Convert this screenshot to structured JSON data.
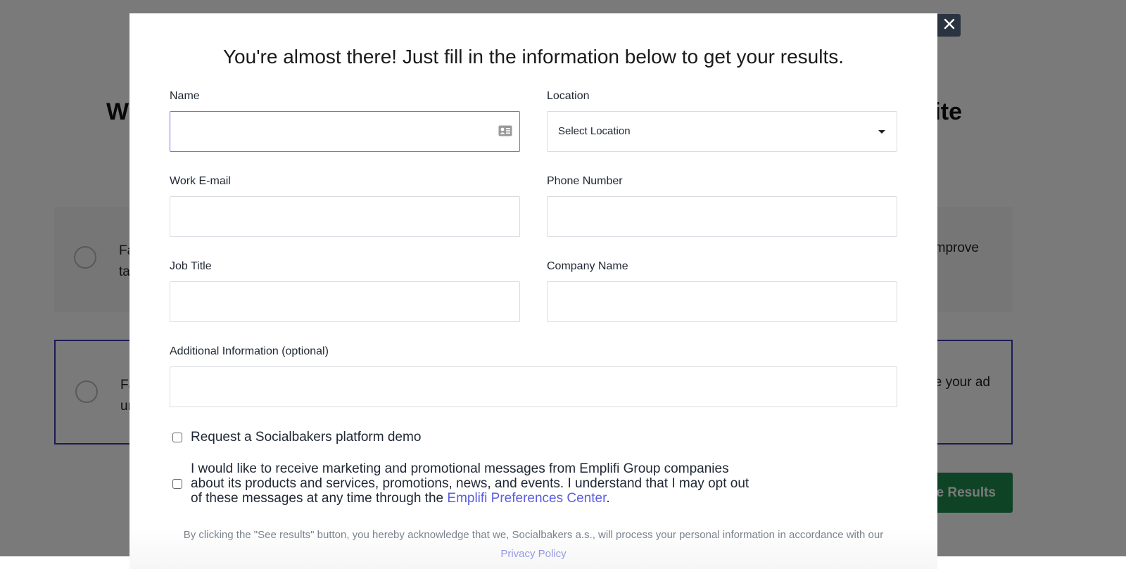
{
  "background": {
    "heading_left": "Wh",
    "heading_right": "ite",
    "cards": [
      {
        "left_text_line1": "Fa",
        "left_text_line2": "ta",
        "right_text": "mprove"
      },
      {
        "left_text_line1": "Fa",
        "left_text_line2": "ur",
        "right_text": "e your ad"
      }
    ],
    "see_results_button": "e Results"
  },
  "modal": {
    "close_icon": "close-icon",
    "title": "You're almost there! Just fill in the information below to get your results.",
    "fields": {
      "name": {
        "label": "Name",
        "value": "",
        "icon": "contact-card-icon"
      },
      "location": {
        "label": "Location",
        "selected": "Select Location"
      },
      "work_email": {
        "label": "Work E-mail",
        "value": ""
      },
      "phone": {
        "label": "Phone Number",
        "value": ""
      },
      "job_title": {
        "label": "Job Title",
        "value": ""
      },
      "company": {
        "label": "Company Name",
        "value": ""
      },
      "additional": {
        "label": "Additional Information (optional)",
        "value": ""
      }
    },
    "checkboxes": {
      "demo": {
        "label": "Request a Socialbakers platform demo",
        "checked": false
      },
      "marketing": {
        "label_before_link": "I would like to receive marketing and promotional messages from Emplifi Group companies about its products and services, promotions, news, and events. I understand that I may opt out of these messages at any time through the ",
        "link_text": "Emplifi Preferences Center",
        "label_after_link": ".",
        "checked": false
      }
    },
    "legal": {
      "text": "By clicking the \"See results\" button, you hereby acknowledge that we, Socialbakers a.s., will process your personal information in accordance with our",
      "privacy_link": "Privacy Policy"
    }
  },
  "colors": {
    "focus_border": "#6f73e6",
    "link": "#5a5fe0",
    "close_bg": "#2b3340",
    "cta_green": "#1f8f4e"
  }
}
